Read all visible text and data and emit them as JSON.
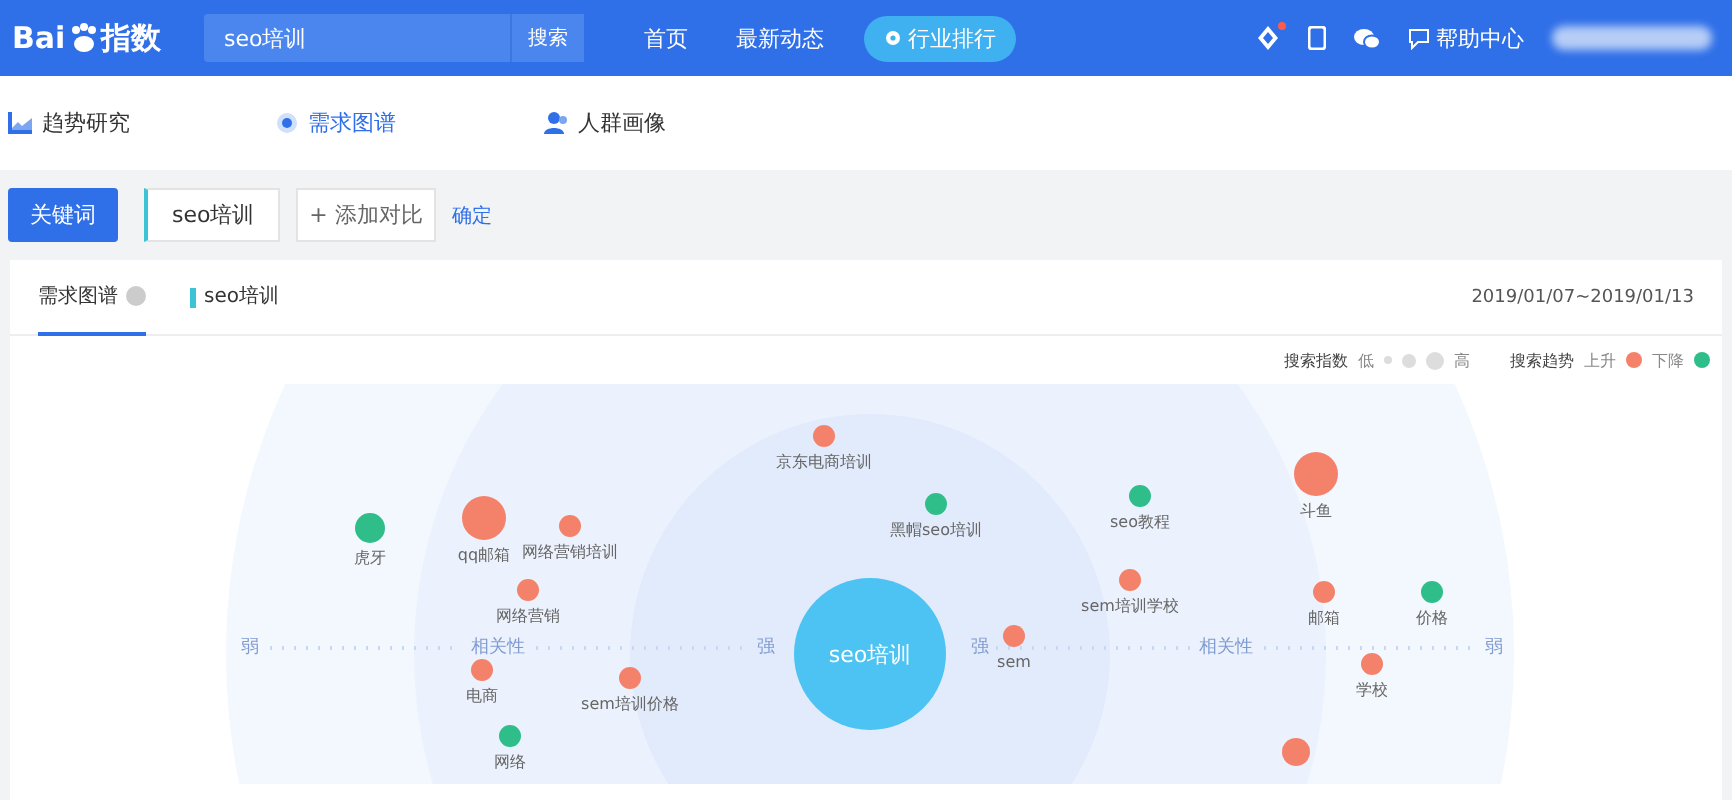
{
  "header": {
    "logo_left": "Bai",
    "logo_right": "指数",
    "search": {
      "value": "seo培训",
      "button": "搜索"
    },
    "nav": [
      {
        "label": "首页",
        "kind": "link"
      },
      {
        "label": "最新动态",
        "kind": "link"
      },
      {
        "label": "行业排行",
        "kind": "pill"
      }
    ],
    "help": "帮助中心",
    "has_notice": true
  },
  "subnav": [
    {
      "label": "趋势研究",
      "selected": false
    },
    {
      "label": "需求图谱",
      "selected": true
    },
    {
      "label": "人群画像",
      "selected": false
    }
  ],
  "keyword_bar": {
    "button": "关键词",
    "keyword": "seo培训",
    "add": "+ 添加对比",
    "confirm": "确定"
  },
  "card": {
    "tabs": [
      {
        "label": "需求图谱",
        "selected": true
      }
    ],
    "keyword": "seo培训",
    "date_range": "2019/01/07~2019/01/13",
    "legend": {
      "index_label": "搜索指数",
      "low": "低",
      "high": "高",
      "trend_label": "搜索趋势",
      "up": "上升",
      "down": "下降"
    },
    "graph": {
      "center": "seo培训",
      "axis_left": [
        "弱",
        "相关性",
        "强"
      ],
      "axis_right": [
        "强",
        "相关性",
        "弱"
      ],
      "nodes": [
        {
          "label": "虎牙",
          "color": "#2fbe8a",
          "kind": "medium"
        },
        {
          "label": "qq邮箱",
          "color": "#f4826a",
          "kind": "large"
        },
        {
          "label": "网络营销培训",
          "color": "#f4826a",
          "kind": "small"
        },
        {
          "label": "网络营销",
          "color": "#f4826a",
          "kind": "small"
        },
        {
          "label": "电商",
          "color": "#f4826a",
          "kind": "small"
        },
        {
          "label": "sem培训价格",
          "color": "#f4826a",
          "kind": "small"
        },
        {
          "label": "网络",
          "color": "#2fbe8a",
          "kind": "small"
        },
        {
          "label": "京东电商培训",
          "color": "#f4826a",
          "kind": "small"
        },
        {
          "label": "黑帽seo培训",
          "color": "#2fbe8a",
          "kind": "small"
        },
        {
          "label": "seo教程",
          "color": "#2fbe8a",
          "kind": "small"
        },
        {
          "label": "sem培训学校",
          "color": "#f4826a",
          "kind": "small"
        },
        {
          "label": "sem",
          "color": "#f4826a",
          "kind": "small"
        },
        {
          "label": "斗鱼",
          "color": "#f4826a",
          "kind": "large"
        },
        {
          "label": "邮箱",
          "color": "#f4826a",
          "kind": "small"
        },
        {
          "label": "价格",
          "color": "#2fbe8a",
          "kind": "small"
        },
        {
          "label": "学校",
          "color": "#f4826a",
          "kind": "small"
        }
      ]
    }
  }
}
